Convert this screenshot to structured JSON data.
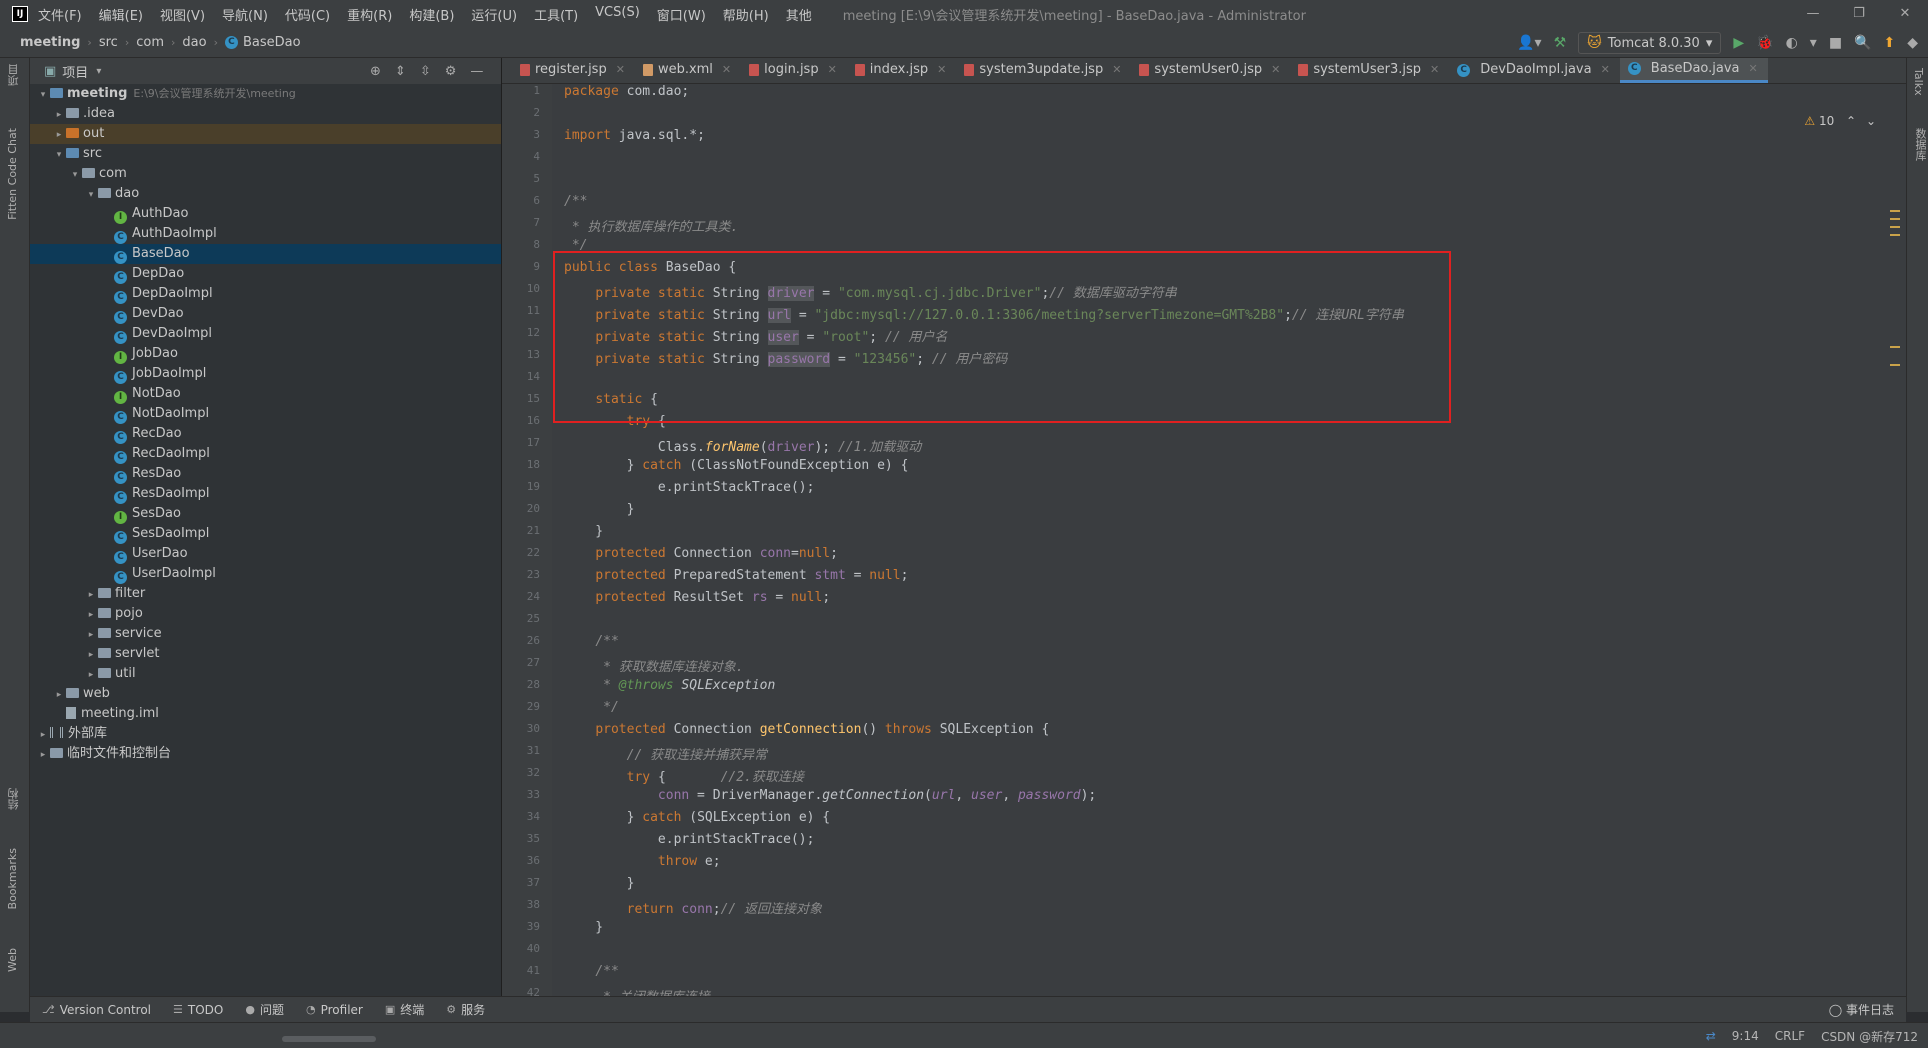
{
  "titlebar": {
    "logo": "IJ",
    "menu": [
      "文件(F)",
      "编辑(E)",
      "视图(V)",
      "导航(N)",
      "代码(C)",
      "重构(R)",
      "构建(B)",
      "运行(U)",
      "工具(T)",
      "VCS(S)",
      "窗口(W)",
      "帮助(H)",
      "其他"
    ],
    "window_title": "meeting [E:\\9\\会议管理系统开发\\meeting] - BaseDao.java - Administrator",
    "controls": [
      "—",
      "❐",
      "✕"
    ]
  },
  "navbar": {
    "breadcrumb": [
      "meeting",
      "src",
      "com",
      "dao",
      "BaseDao"
    ],
    "run_config": "Tomcat 8.0.30"
  },
  "left_strip": {
    "labels": [
      "项目",
      "Fitten Code Chat",
      "结构",
      "Bookmarks",
      "Web"
    ]
  },
  "right_strip": {
    "labels": [
      "Talkx",
      "数据库"
    ]
  },
  "project": {
    "header": "项目",
    "tree": [
      {
        "label": "meeting",
        "path": "E:\\9\\会议管理系统开发\\meeting",
        "depth": 0,
        "kind": "module",
        "arrow": "▾"
      },
      {
        "label": ".idea",
        "depth": 1,
        "kind": "folder",
        "arrow": "▸"
      },
      {
        "label": "out",
        "depth": 1,
        "kind": "out",
        "arrow": "▸"
      },
      {
        "label": "src",
        "depth": 1,
        "kind": "src",
        "arrow": "▾"
      },
      {
        "label": "com",
        "depth": 2,
        "kind": "pkg",
        "arrow": "▾"
      },
      {
        "label": "dao",
        "depth": 3,
        "kind": "pkg",
        "arrow": "▾"
      },
      {
        "label": "AuthDao",
        "depth": 4,
        "kind": "interface"
      },
      {
        "label": "AuthDaoImpl",
        "depth": 4,
        "kind": "class"
      },
      {
        "label": "BaseDao",
        "depth": 4,
        "kind": "class",
        "selected": true
      },
      {
        "label": "DepDao",
        "depth": 4,
        "kind": "class"
      },
      {
        "label": "DepDaoImpl",
        "depth": 4,
        "kind": "class"
      },
      {
        "label": "DevDao",
        "depth": 4,
        "kind": "class"
      },
      {
        "label": "DevDaoImpl",
        "depth": 4,
        "kind": "class"
      },
      {
        "label": "JobDao",
        "depth": 4,
        "kind": "interface"
      },
      {
        "label": "JobDaoImpl",
        "depth": 4,
        "kind": "class"
      },
      {
        "label": "NotDao",
        "depth": 4,
        "kind": "interface"
      },
      {
        "label": "NotDaoImpl",
        "depth": 4,
        "kind": "class"
      },
      {
        "label": "RecDao",
        "depth": 4,
        "kind": "class"
      },
      {
        "label": "RecDaoImpl",
        "depth": 4,
        "kind": "class"
      },
      {
        "label": "ResDao",
        "depth": 4,
        "kind": "class"
      },
      {
        "label": "ResDaoImpl",
        "depth": 4,
        "kind": "class"
      },
      {
        "label": "SesDao",
        "depth": 4,
        "kind": "interface"
      },
      {
        "label": "SesDaoImpl",
        "depth": 4,
        "kind": "class"
      },
      {
        "label": "UserDao",
        "depth": 4,
        "kind": "class"
      },
      {
        "label": "UserDaoImpl",
        "depth": 4,
        "kind": "class"
      },
      {
        "label": "filter",
        "depth": 3,
        "kind": "pkg",
        "arrow": "▸"
      },
      {
        "label": "pojo",
        "depth": 3,
        "kind": "pkg",
        "arrow": "▸"
      },
      {
        "label": "service",
        "depth": 3,
        "kind": "pkg",
        "arrow": "▸"
      },
      {
        "label": "servlet",
        "depth": 3,
        "kind": "pkg",
        "arrow": "▸"
      },
      {
        "label": "util",
        "depth": 3,
        "kind": "pkg",
        "arrow": "▸"
      },
      {
        "label": "web",
        "depth": 1,
        "kind": "folder",
        "arrow": "▸"
      },
      {
        "label": "meeting.iml",
        "depth": 1,
        "kind": "file"
      },
      {
        "label": "外部库",
        "depth": 0,
        "kind": "lib",
        "arrow": "▸"
      },
      {
        "label": "临时文件和控制台",
        "depth": 0,
        "kind": "scratch",
        "arrow": "▸"
      }
    ]
  },
  "editor": {
    "tabs": [
      {
        "label": "register.jsp",
        "kind": "jsp"
      },
      {
        "label": "web.xml",
        "kind": "xml"
      },
      {
        "label": "login.jsp",
        "kind": "jsp"
      },
      {
        "label": "index.jsp",
        "kind": "jsp"
      },
      {
        "label": "system3update.jsp",
        "kind": "jsp"
      },
      {
        "label": "systemUser0.jsp",
        "kind": "jsp"
      },
      {
        "label": "systemUser3.jsp",
        "kind": "jsp"
      },
      {
        "label": "DevDaoImpl.java",
        "kind": "class"
      },
      {
        "label": "BaseDao.java",
        "kind": "class",
        "active": true
      }
    ],
    "warnings": "10",
    "first_line": 1,
    "lines": [
      [
        [
          "kw",
          "package "
        ],
        [
          "",
          "com.dao;"
        ]
      ],
      [],
      [
        [
          "kw",
          "import "
        ],
        [
          "",
          "java.sql.*;"
        ]
      ],
      [],
      [],
      [
        [
          "cmt",
          "/**"
        ]
      ],
      [
        [
          "cmt",
          " * 执行数据库操作的工具类."
        ]
      ],
      [
        [
          "cmt",
          " */"
        ]
      ],
      [
        [
          "kw",
          "public class "
        ],
        [
          "",
          "BaseDao {"
        ]
      ],
      [
        [
          "",
          "    "
        ],
        [
          "kw",
          "private static "
        ],
        [
          "",
          "String "
        ],
        [
          "hl-var",
          "driver"
        ],
        [
          "",
          " = "
        ],
        [
          "str",
          "\"com.mysql.cj.jdbc.Driver\""
        ],
        [
          "",
          ";"
        ],
        [
          "cmt",
          "// 数据库驱动字符串"
        ]
      ],
      [
        [
          "",
          "    "
        ],
        [
          "kw",
          "private static "
        ],
        [
          "",
          "String "
        ],
        [
          "hl-var",
          "url"
        ],
        [
          "",
          " = "
        ],
        [
          "str",
          "\"jdbc:mysql://127.0.0.1:3306/meeting?serverTimezone=GMT%2B8\""
        ],
        [
          "",
          ";"
        ],
        [
          "cmt",
          "// 连接URL字符串"
        ]
      ],
      [
        [
          "",
          "    "
        ],
        [
          "kw",
          "private static "
        ],
        [
          "",
          "String "
        ],
        [
          "hl-var",
          "user"
        ],
        [
          "",
          " = "
        ],
        [
          "str",
          "\"root\""
        ],
        [
          "",
          "; "
        ],
        [
          "cmt",
          "// 用户名"
        ]
      ],
      [
        [
          "",
          "    "
        ],
        [
          "kw",
          "private static "
        ],
        [
          "",
          "String "
        ],
        [
          "hl-var",
          "password"
        ],
        [
          "",
          " = "
        ],
        [
          "str",
          "\"123456\""
        ],
        [
          "",
          "; "
        ],
        [
          "cmt",
          "// 用户密码"
        ]
      ],
      [],
      [
        [
          "",
          "    "
        ],
        [
          "kw",
          "static "
        ],
        [
          "",
          "{"
        ]
      ],
      [
        [
          "",
          "        "
        ],
        [
          "kw",
          "try "
        ],
        [
          "",
          "{"
        ]
      ],
      [
        [
          "",
          "            Class."
        ],
        [
          "fn italic",
          "forName"
        ],
        [
          "",
          "("
        ],
        [
          "fld",
          "driver"
        ],
        [
          "",
          "); "
        ],
        [
          "cmt",
          "//1.加载驱动"
        ]
      ],
      [
        [
          "",
          "        } "
        ],
        [
          "kw",
          "catch "
        ],
        [
          "",
          "(ClassNotFoundException e) {"
        ]
      ],
      [
        [
          "",
          "            e.printStackTrace();"
        ]
      ],
      [
        [
          "",
          "        }"
        ]
      ],
      [
        [
          "",
          "    }"
        ]
      ],
      [
        [
          "",
          "    "
        ],
        [
          "kw",
          "protected "
        ],
        [
          "",
          "Connection "
        ],
        [
          "fld",
          "conn"
        ],
        [
          "",
          "="
        ],
        [
          "kw",
          "null"
        ],
        [
          "",
          ";"
        ]
      ],
      [
        [
          "",
          "    "
        ],
        [
          "kw",
          "protected "
        ],
        [
          "",
          "PreparedStatement "
        ],
        [
          "fld",
          "stmt"
        ],
        [
          "",
          " = "
        ],
        [
          "kw",
          "null"
        ],
        [
          "",
          ";"
        ]
      ],
      [
        [
          "",
          "    "
        ],
        [
          "kw",
          "protected "
        ],
        [
          "",
          "ResultSet "
        ],
        [
          "fld",
          "rs"
        ],
        [
          "",
          " = "
        ],
        [
          "kw",
          "null"
        ],
        [
          "",
          ";"
        ]
      ],
      [],
      [
        [
          "",
          "    "
        ],
        [
          "cmt",
          "/**"
        ]
      ],
      [
        [
          "",
          "     "
        ],
        [
          "cmt",
          "* 获取数据库连接对象."
        ]
      ],
      [
        [
          "",
          "     "
        ],
        [
          "cmt",
          "* "
        ],
        [
          "doc",
          "@throws"
        ],
        [
          "italic",
          " SQLException"
        ]
      ],
      [
        [
          "",
          "     "
        ],
        [
          "cmt",
          "*/"
        ]
      ],
      [
        [
          "",
          "    "
        ],
        [
          "kw",
          "protected "
        ],
        [
          "",
          "Connection "
        ],
        [
          "fn",
          "getConnection"
        ],
        [
          "",
          "() "
        ],
        [
          "kw",
          "throws "
        ],
        [
          "",
          "SQLException {"
        ]
      ],
      [
        [
          "",
          "        "
        ],
        [
          "cmt",
          "// 获取连接并捕获异常"
        ]
      ],
      [
        [
          "",
          "        "
        ],
        [
          "kw",
          "try "
        ],
        [
          "",
          "{       "
        ],
        [
          "cmt",
          "//2.获取连接"
        ]
      ],
      [
        [
          "",
          "            "
        ],
        [
          "fld",
          "conn"
        ],
        [
          "",
          " = DriverManager."
        ],
        [
          "italic",
          "getConnection"
        ],
        [
          "",
          "("
        ],
        [
          "fld italic",
          "url"
        ],
        [
          "",
          ", "
        ],
        [
          "fld italic",
          "user"
        ],
        [
          "",
          ", "
        ],
        [
          "fld italic",
          "password"
        ],
        [
          "",
          ");"
        ]
      ],
      [
        [
          "",
          "        } "
        ],
        [
          "kw",
          "catch "
        ],
        [
          "",
          "(SQLException e) {"
        ]
      ],
      [
        [
          "",
          "            e.printStackTrace();"
        ]
      ],
      [
        [
          "",
          "            "
        ],
        [
          "kw",
          "throw "
        ],
        [
          "",
          "e;"
        ]
      ],
      [
        [
          "",
          "        }"
        ]
      ],
      [
        [
          "",
          "        "
        ],
        [
          "kw",
          "return "
        ],
        [
          "fld",
          "conn"
        ],
        [
          "",
          ";"
        ],
        [
          "cmt",
          "// 返回连接对象"
        ]
      ],
      [
        [
          "",
          "    }"
        ]
      ],
      [],
      [
        [
          "",
          "    "
        ],
        [
          "cmt",
          "/**"
        ]
      ],
      [
        [
          "",
          "     "
        ],
        [
          "cmt",
          "* 关闭数据库连接."
        ]
      ]
    ]
  },
  "bottom_tools": {
    "items": [
      {
        "icon": "⎇",
        "label": "Version Control"
      },
      {
        "icon": "☰",
        "label": "TODO"
      },
      {
        "icon": "●",
        "label": "问题"
      },
      {
        "icon": "◔",
        "label": "Profiler"
      },
      {
        "icon": "▣",
        "label": "终端"
      },
      {
        "icon": "⚙",
        "label": "服务"
      }
    ],
    "event_log": "事件日志"
  },
  "status": {
    "position": "9:14",
    "line_sep": "CRLF",
    "watermark": "CSDN @新存712"
  }
}
